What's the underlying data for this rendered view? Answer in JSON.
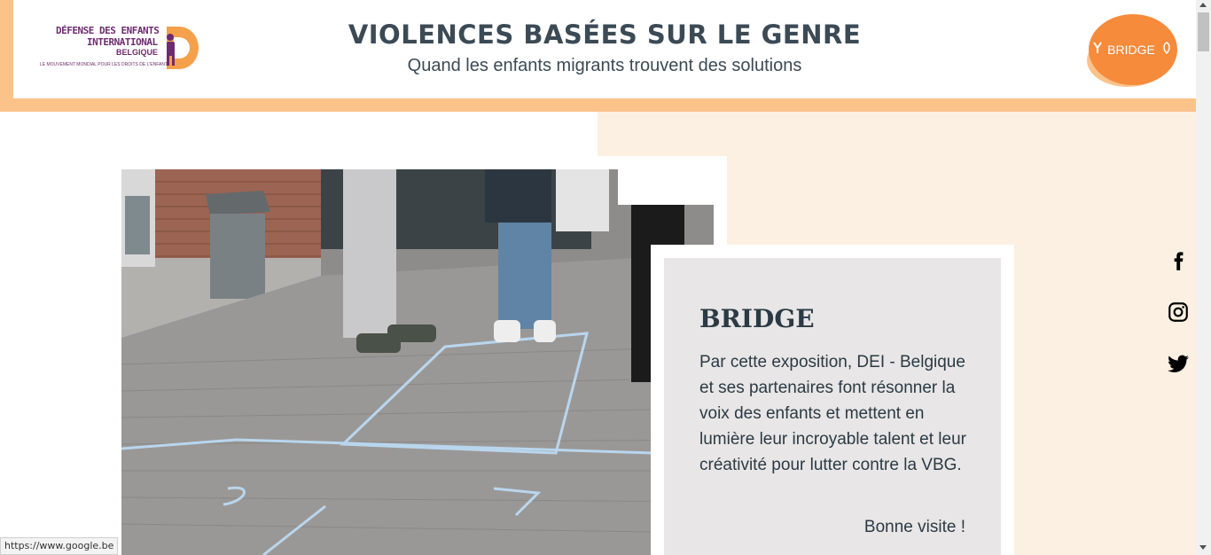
{
  "header": {
    "title": "VIOLENCES BASÉES SUR LE GENRE",
    "subtitle": "Quand les enfants migrants trouvent des solutions",
    "logo_left": {
      "line1": "DÉFENSE DES ENFANTS",
      "line2": "INTERNATIONAL",
      "line3": "BELGIQUE",
      "tagline": "LE MOUVEMENT MONDIAL POUR LES DROITS DE L'ENFANT"
    },
    "logo_right": {
      "text": "BRIDGE"
    }
  },
  "card": {
    "title": "BRIDGE",
    "text": "Par cette exposition, DEI - Belgique et ses partenaires font résonner la voix des enfants et mettent en lumière leur incroyable talent et leur créativité pour lutter contre la VBG.",
    "sign": "Bonne visite !"
  },
  "social": {
    "items": [
      {
        "icon": "facebook-icon"
      },
      {
        "icon": "instagram-icon"
      },
      {
        "icon": "twitter-icon"
      }
    ]
  },
  "statusbar": {
    "url": "https://www.google.be"
  },
  "colors": {
    "accent_orange": "#fbc28a",
    "beige": "#fbf0e2",
    "card_gray": "#e8e6e6",
    "text_dark": "#3b4a55",
    "dei_purple": "#6d2c6f",
    "bridge_orange": "#f58b3b"
  }
}
